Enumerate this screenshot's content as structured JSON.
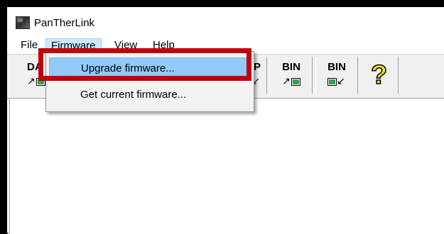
{
  "window": {
    "title": "PanTherLink"
  },
  "menubar": {
    "items": [
      "File",
      "Firmware",
      "View",
      "Help"
    ],
    "active": "Firmware"
  },
  "toolbar": {
    "buttons": [
      {
        "label": "DA",
        "icon": "send-arrow-pc-icon"
      },
      {
        "label": "P",
        "icon": "receive-arrow-pc-icon"
      },
      {
        "label": "BIN",
        "icon": "send-bin-icon"
      },
      {
        "label": "BIN",
        "icon": "receive-bin-icon"
      }
    ],
    "help_icon": "question-mark-icon",
    "help_glyph": "?"
  },
  "firmware_menu": {
    "items": [
      "Upgrade firmware...",
      "Get current firmware..."
    ],
    "highlighted": "Upgrade firmware..."
  },
  "colors": {
    "highlight_border": "#c0000c",
    "menu_hover": "#91c9f7",
    "help_icon": "#f7e21a"
  }
}
